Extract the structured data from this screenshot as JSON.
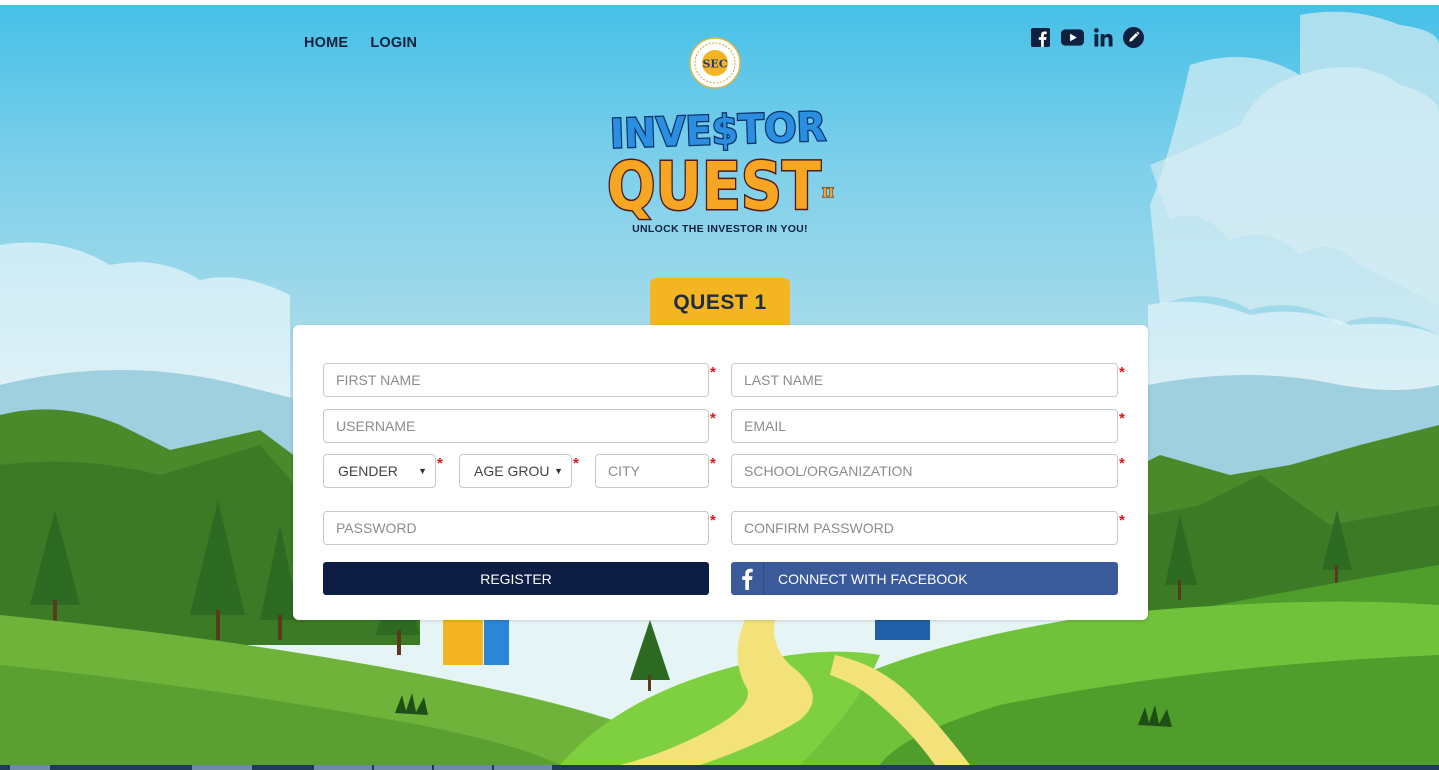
{
  "nav": {
    "home": "HOME",
    "login": "LOGIN"
  },
  "social": {
    "icons": [
      "facebook-icon",
      "youtube-icon",
      "linkedin-icon",
      "blog-pencil-icon"
    ],
    "color": "#10203f"
  },
  "branding": {
    "seal_text": "SEC",
    "logo_line1": "INVE$TOR",
    "logo_line2": "QUEST",
    "logo_suffix": "II",
    "tagline": "UNLOCK THE INVESTOR IN YOU!"
  },
  "quest_tab": "QUEST 1",
  "form": {
    "first_name": "FIRST NAME",
    "last_name": "LAST NAME",
    "username": "USERNAME",
    "email": "EMAIL",
    "gender": "GENDER",
    "age_group": "AGE GROU",
    "city": "CITY",
    "school": "SCHOOL/ORGANIZATION",
    "password": "PASSWORD",
    "confirm_password": "CONFIRM PASSWORD",
    "required_mark": "*",
    "register_label": "REGISTER",
    "facebook_label": "CONNECT WITH FACEBOOK"
  },
  "colors": {
    "accent_yellow": "#f3b622",
    "navy": "#0e1d44",
    "facebook_blue": "#3b5a9a",
    "required_red": "#e0141b"
  }
}
